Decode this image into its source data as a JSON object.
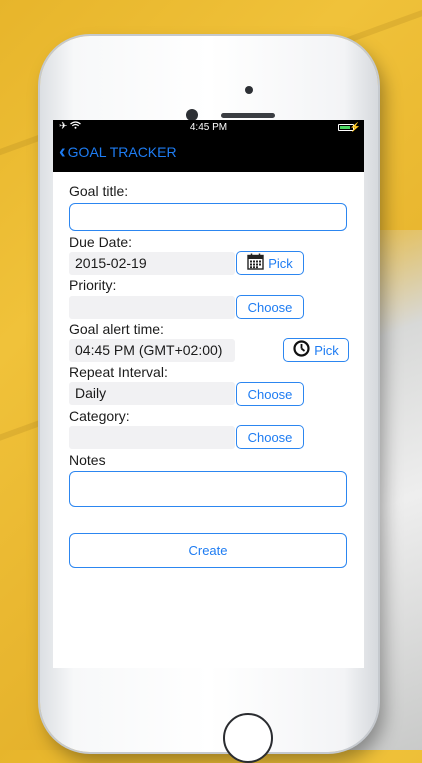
{
  "status_bar": {
    "time": "4:45 PM"
  },
  "nav": {
    "back_label": "GOAL TRACKER"
  },
  "form": {
    "goal_title_label": "Goal title:",
    "goal_title_value": "",
    "due_date_label": "Due Date:",
    "due_date_value": "2015-02-19",
    "due_date_pick": "Pick",
    "priority_label": "Priority:",
    "priority_value": "",
    "priority_choose": "Choose",
    "alert_time_label": "Goal alert time:",
    "alert_time_value": "04:45 PM (GMT+02:00)",
    "alert_time_pick": "Pick",
    "repeat_label": "Repeat Interval:",
    "repeat_value": "Daily",
    "repeat_choose": "Choose",
    "category_label": "Category:",
    "category_value": "",
    "category_choose": "Choose",
    "notes_label": "Notes",
    "notes_value": "",
    "create_label": "Create"
  },
  "colors": {
    "accent": "#1e7cf2",
    "nav_bg": "#000000",
    "field_bg": "#f1f1f3"
  },
  "icons": [
    "airplane-icon",
    "wifi-icon",
    "battery-icon",
    "chevron-left-icon",
    "calendar-icon",
    "clock-icon"
  ]
}
